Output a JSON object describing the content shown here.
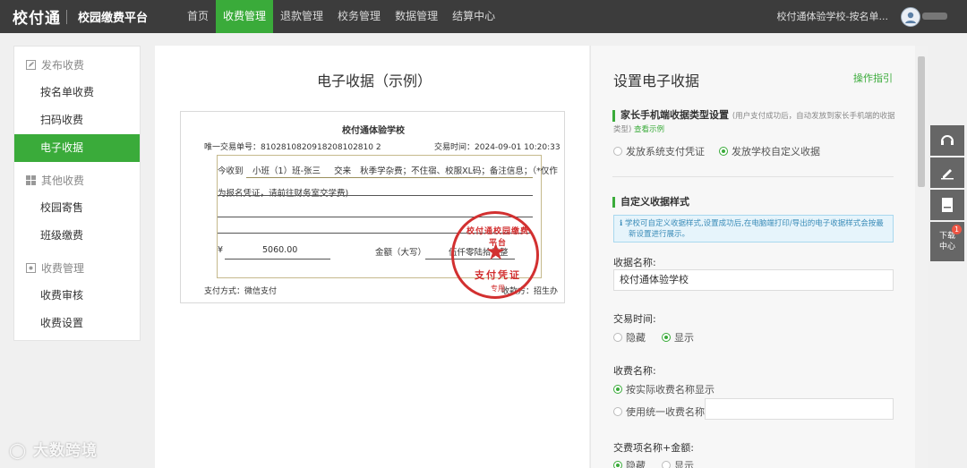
{
  "header": {
    "logo": "校付通",
    "platform": "校园缴费平台",
    "nav": [
      "首页",
      "收费管理",
      "退款管理",
      "校务管理",
      "数据管理",
      "结算中心"
    ],
    "active_nav": "收费管理",
    "school": "校付通体验学校-按名单..."
  },
  "sidebar": {
    "groups": [
      {
        "title": "发布收费",
        "items": [
          "按名单收费",
          "扫码收费",
          "电子收据"
        ]
      },
      {
        "title": "其他收费",
        "items": [
          "校园寄售",
          "班级缴费"
        ]
      },
      {
        "title": "收费管理",
        "items": [
          "收费审核",
          "收费设置"
        ]
      }
    ],
    "active_item": "电子收据"
  },
  "left": {
    "title": "电子收据（示例）",
    "receipt": {
      "school": "校付通体验学校",
      "txn_label": "唯一交易单号：",
      "txn_no": "8102810820918208102810 2",
      "time_label": "交易时间：",
      "time": "2024-09-01 10:20:33",
      "received_prefix": "今收到",
      "payer": "小班（1）班-张三",
      "pay_word": "交来",
      "items_line1": "秋季学杂费；不住宿、校服XL码；备注信息；（*仅作",
      "items_line2": "为报名凭证，请前往财务室交学费)",
      "currency": "¥",
      "amount": "5060.00",
      "amount_cn_label": "金额（大写）",
      "amount_cn": "伍仟零陆拾元整",
      "pay_method_label": "支付方式：",
      "pay_method": "微信支付",
      "issuer_label": "收款方：",
      "issuer": "招生办",
      "stamp_top": "校付通校园缴费平台",
      "stamp_mid": "支付凭证",
      "stamp_bot": "专用"
    }
  },
  "right": {
    "title": "设置电子收据",
    "guide": "操作指引",
    "sec1_title": "家长手机端收据类型设置",
    "sec1_note": "(用户支付成功后，自动发放到家长手机端的收据",
    "sec1_note2": "类型)",
    "sec1_link": "查看示例",
    "sec1_options": [
      "发放系统支付凭证",
      "发放学校自定义收据"
    ],
    "sec2_title": "自定义收据样式",
    "info_line1": "学校可自定义收据样式,设置成功后,在电脑端打印/导出的电子收据样式会按最",
    "info_line2": "新设置进行展示。",
    "name_label": "收据名称:",
    "name_value": "校付通体验学校",
    "time_label": "交易时间:",
    "time_options": [
      "隐藏",
      "显示"
    ],
    "fee_label": "收费名称:",
    "fee_options": [
      "按实际收费名称显示",
      "使用统一收费名称"
    ],
    "items_label": "交费项名称+金额:",
    "items_options": [
      "隐藏",
      "显示"
    ]
  },
  "tools": {
    "download_label": "下载中心",
    "download_count": "1"
  },
  "watermark": "大数跨境"
}
